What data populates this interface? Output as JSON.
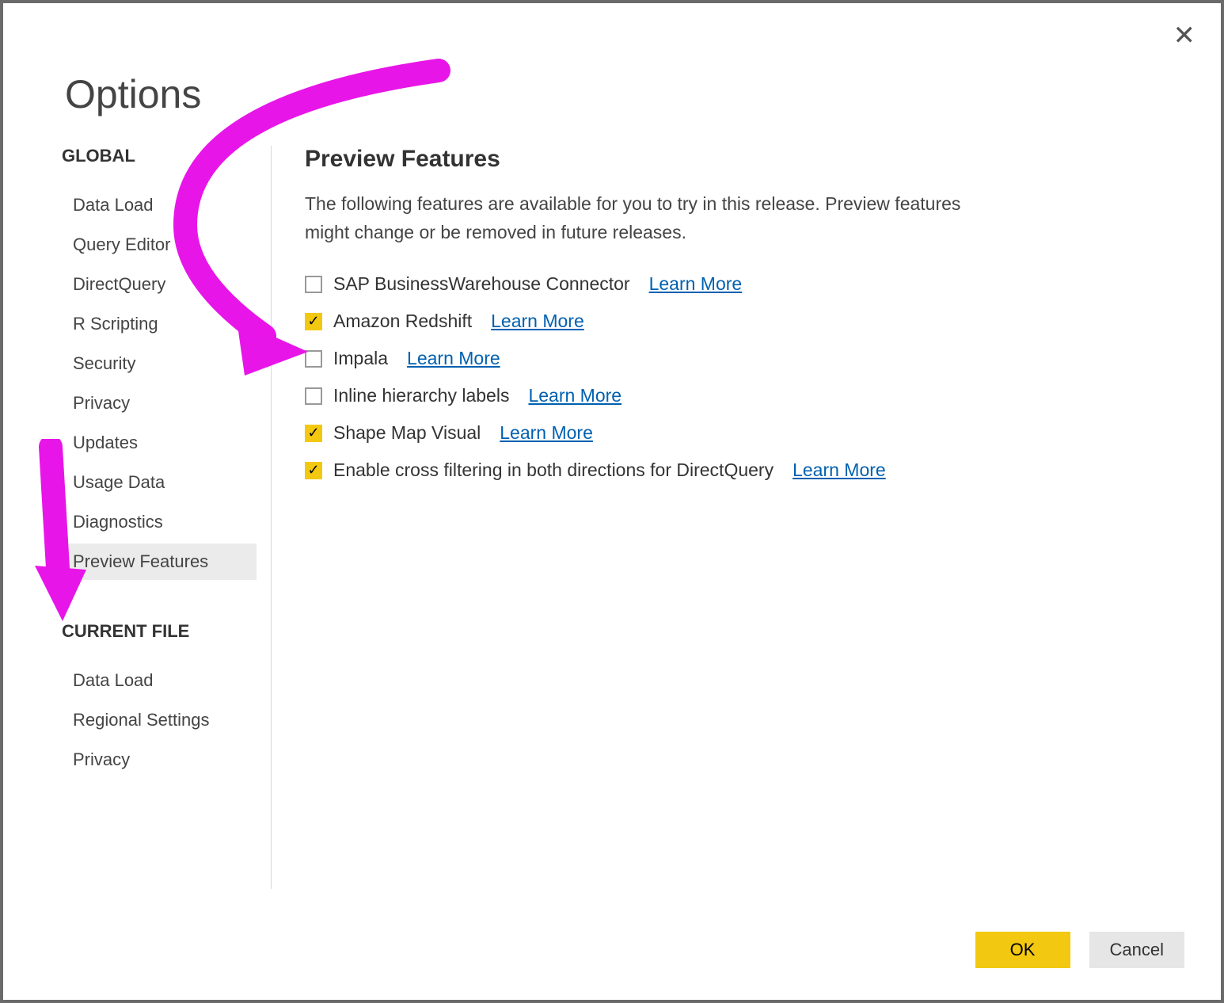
{
  "window": {
    "title": "Options",
    "ok_label": "OK",
    "cancel_label": "Cancel"
  },
  "sidebar": {
    "global_head": "GLOBAL",
    "current_head": "CURRENT FILE",
    "global_items": [
      "Data Load",
      "Query Editor",
      "DirectQuery",
      "R Scripting",
      "Security",
      "Privacy",
      "Updates",
      "Usage Data",
      "Diagnostics",
      "Preview Features"
    ],
    "selected_global": "Preview Features",
    "current_items": [
      "Data Load",
      "Regional Settings",
      "Privacy"
    ]
  },
  "content": {
    "heading": "Preview Features",
    "description": "The following features are available for you to try in this release. Preview features might change or be removed in future releases.",
    "learn_more_label": "Learn More",
    "features": [
      {
        "label": "SAP BusinessWarehouse Connector",
        "checked": false
      },
      {
        "label": "Amazon Redshift",
        "checked": true
      },
      {
        "label": "Impala",
        "checked": false
      },
      {
        "label": "Inline hierarchy labels",
        "checked": false
      },
      {
        "label": "Shape Map Visual",
        "checked": true
      },
      {
        "label": "Enable cross filtering in both directions for DirectQuery",
        "checked": true
      }
    ]
  },
  "colors": {
    "accent": "#f2c811",
    "link": "#0060b0",
    "annotation": "#e815e8"
  }
}
